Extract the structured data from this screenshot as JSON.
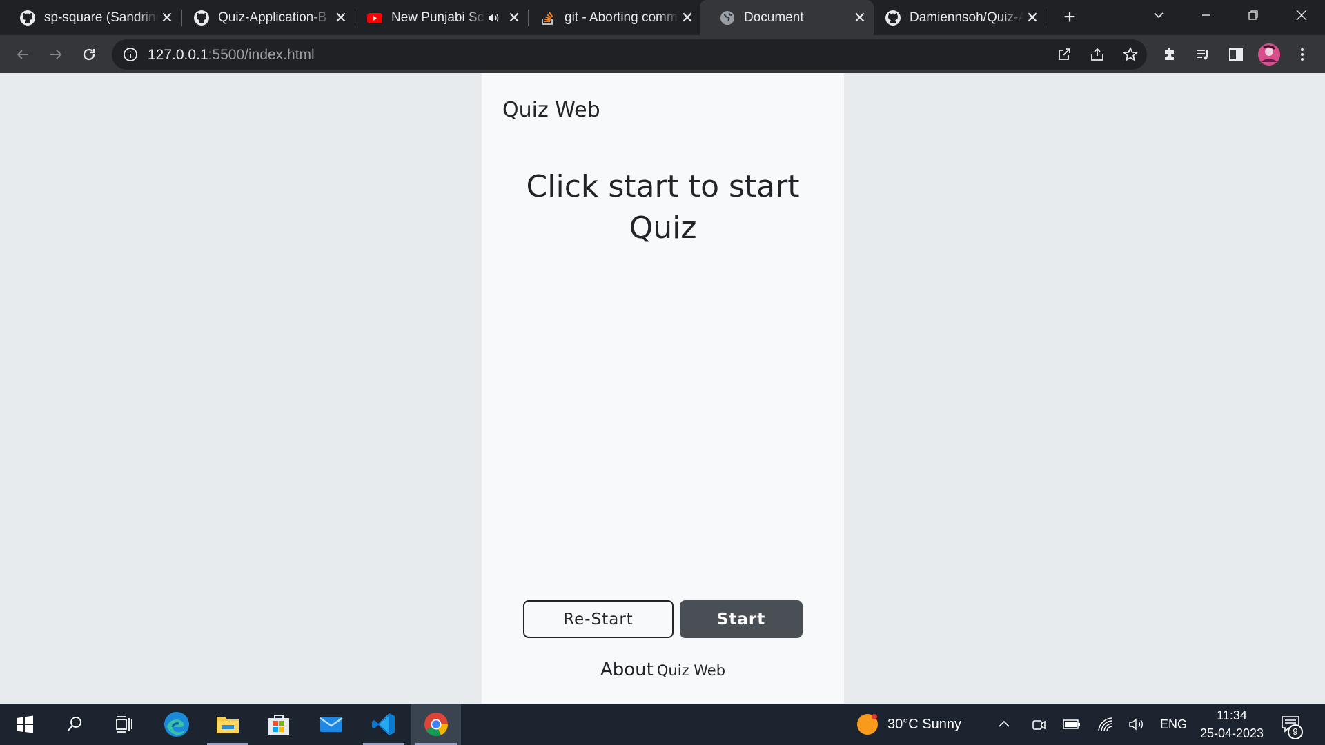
{
  "browser": {
    "tabs": [
      {
        "title": "sp-square (Sandrine",
        "icon": "github-icon"
      },
      {
        "title": "Quiz-Application-B",
        "icon": "github-icon"
      },
      {
        "title": "New Punjabi Sc",
        "icon": "youtube-icon"
      },
      {
        "title": "git - Aborting comm",
        "icon": "stackoverflow-icon"
      },
      {
        "title": "Document",
        "icon": "globe-icon",
        "active": true
      },
      {
        "title": "Damiennsoh/Quiz-A",
        "icon": "github-icon"
      }
    ],
    "url_host": "127.0.0.1",
    "url_rest": ":5500/index.html"
  },
  "page": {
    "brand": "Quiz Web",
    "question": "Click start to start Quiz",
    "restart_label": "Re-Start",
    "start_label": "Start",
    "about_prefix": "About",
    "about_name": "Quiz Web"
  },
  "taskbar": {
    "weather": "30°C  Sunny",
    "language": "ENG",
    "time": "11:34",
    "date": "25-04-2023",
    "notifications": "9"
  },
  "colors": {
    "accent_button": "#4a4f55",
    "page_background": "#e8ebee",
    "card_background": "#f8f9fa"
  }
}
